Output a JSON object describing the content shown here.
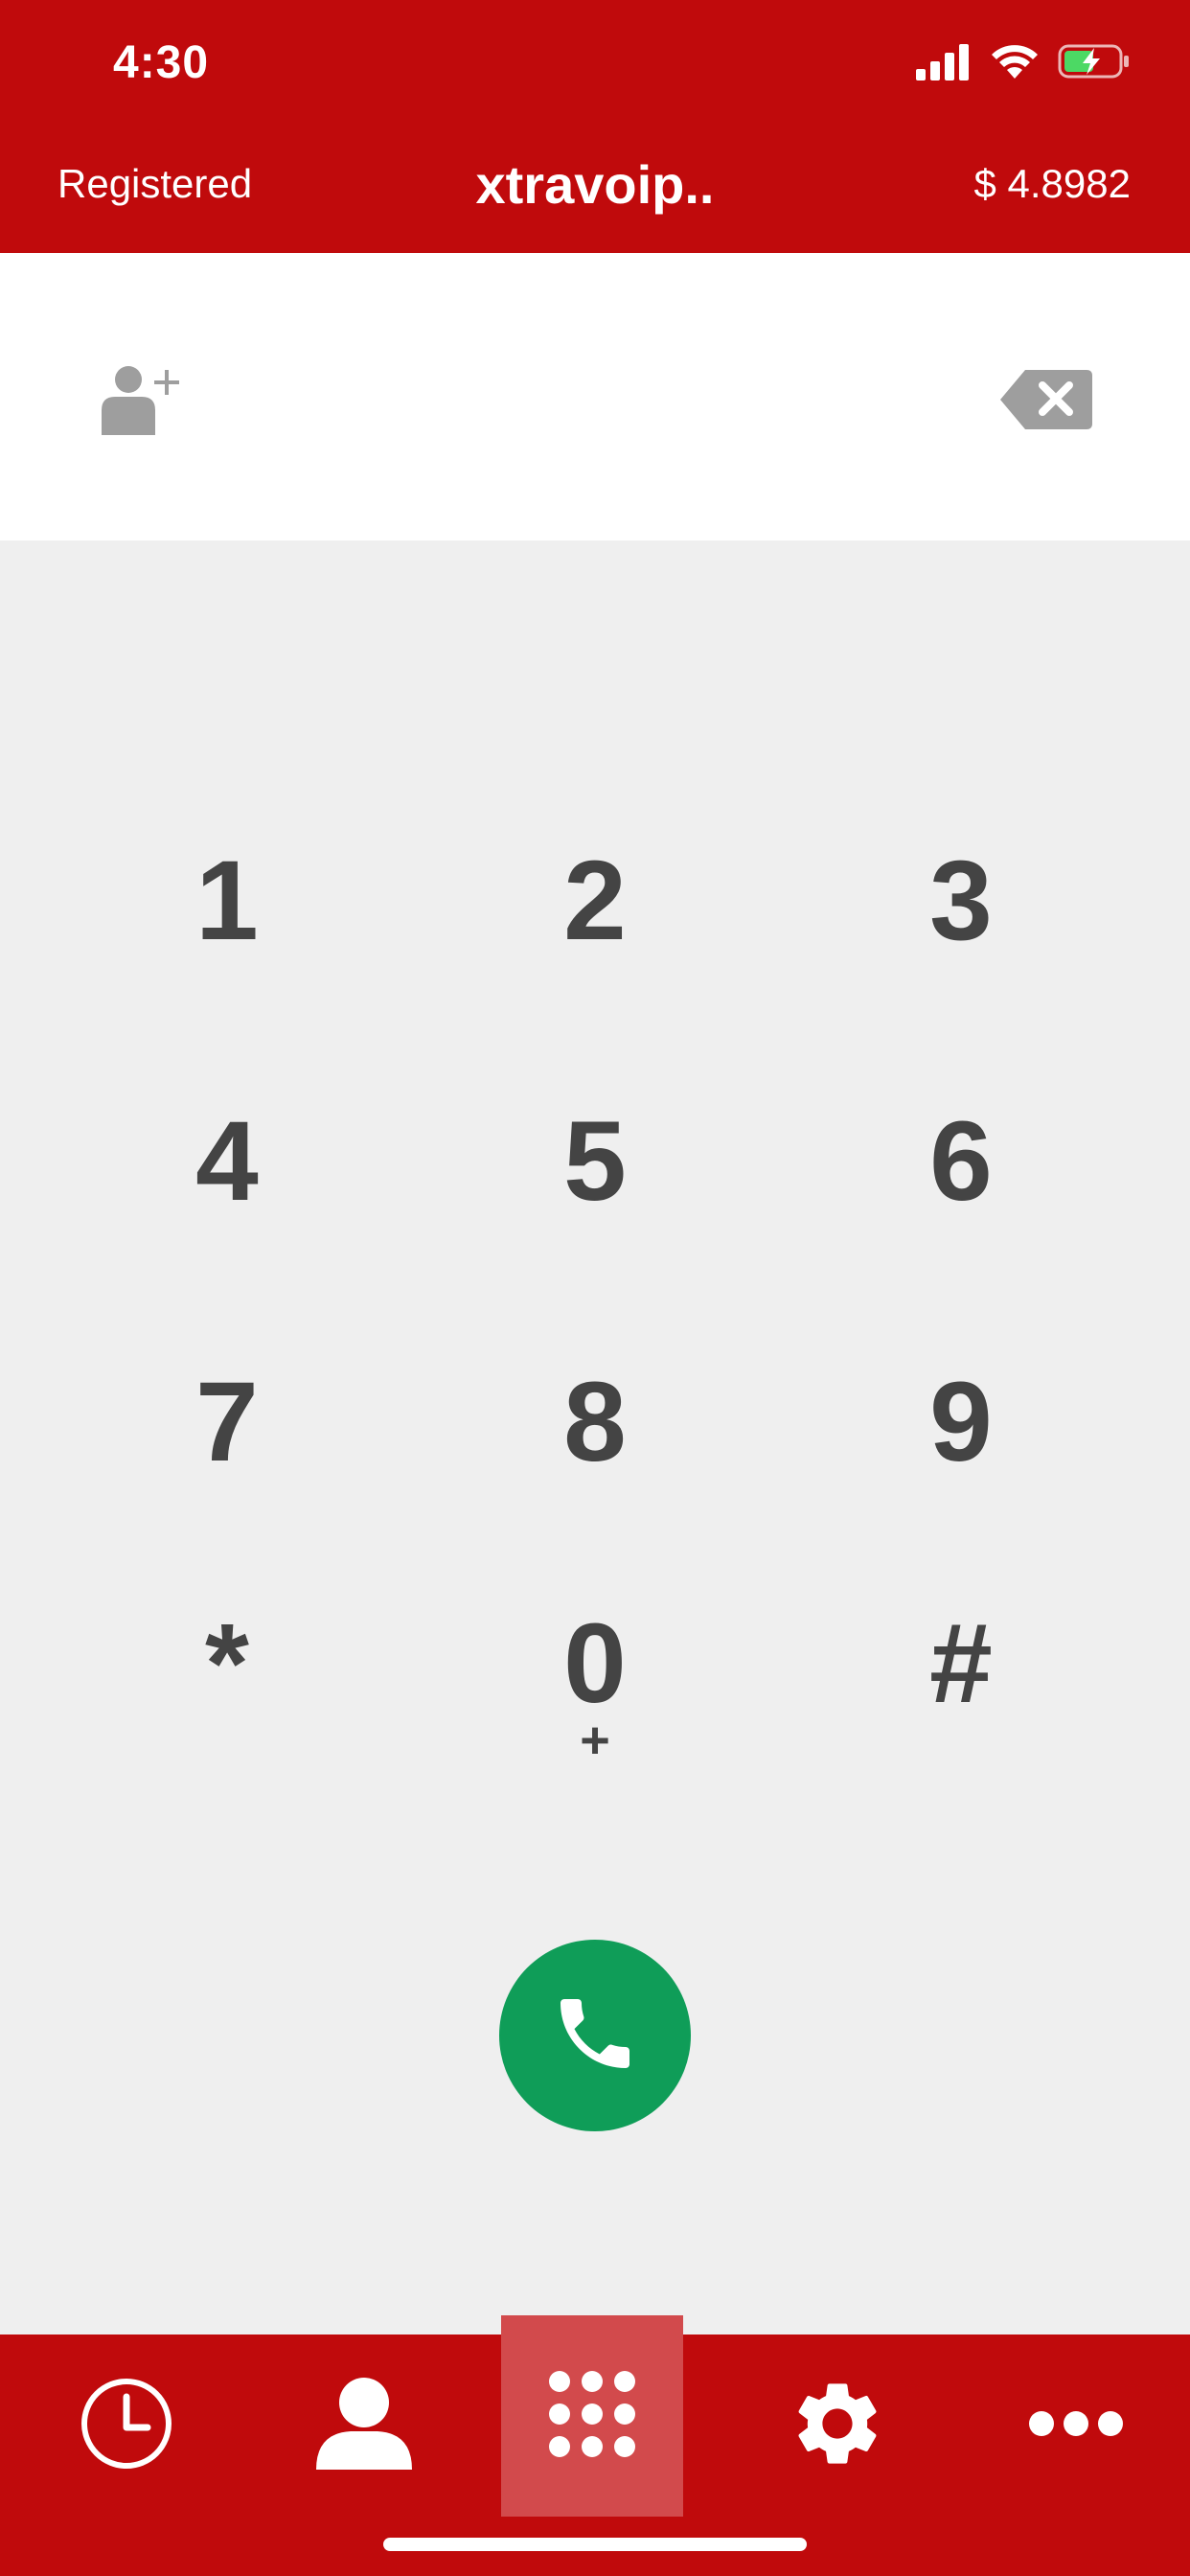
{
  "status_bar": {
    "time": "4:30"
  },
  "header": {
    "registration_status": "Registered",
    "title": "xtravoip..",
    "balance": "$ 4.8982"
  },
  "number_bar": {
    "add_contact_icon": "add-contact-icon",
    "backspace_icon": "backspace-icon"
  },
  "keypad": {
    "keys": [
      {
        "digit": "1",
        "sub": ""
      },
      {
        "digit": "2",
        "sub": ""
      },
      {
        "digit": "3",
        "sub": ""
      },
      {
        "digit": "4",
        "sub": ""
      },
      {
        "digit": "5",
        "sub": ""
      },
      {
        "digit": "6",
        "sub": ""
      },
      {
        "digit": "7",
        "sub": ""
      },
      {
        "digit": "8",
        "sub": ""
      },
      {
        "digit": "9",
        "sub": ""
      },
      {
        "digit": "*",
        "sub": ""
      },
      {
        "digit": "0",
        "sub": "+"
      },
      {
        "digit": "#",
        "sub": ""
      }
    ]
  },
  "tabs": [
    {
      "icon": "clock-icon",
      "active": false
    },
    {
      "icon": "person-icon",
      "active": false
    },
    {
      "icon": "keypad-icon",
      "active": true
    },
    {
      "icon": "gear-icon",
      "active": false
    },
    {
      "icon": "more-icon",
      "active": false
    }
  ],
  "colors": {
    "brand_red": "#c00a0c",
    "call_green": "#0f9d58",
    "key_text": "#444444",
    "background": "#efefef"
  }
}
